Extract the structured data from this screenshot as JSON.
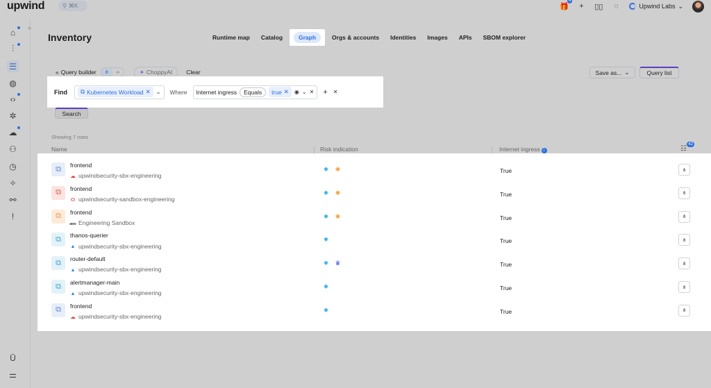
{
  "header": {
    "logo_text": "upwind",
    "search_hint": "⌘K",
    "notifications_count": "4",
    "org_name": "Upwind Labs"
  },
  "page": {
    "title": "Inventory",
    "tabs": [
      {
        "label": "Runtime map"
      },
      {
        "label": "Catalog"
      },
      {
        "label": "Graph"
      },
      {
        "label": "Orgs & accounts"
      },
      {
        "label": "Identities"
      },
      {
        "label": "Images"
      },
      {
        "label": "APIs"
      },
      {
        "label": "SBOM explorer"
      }
    ]
  },
  "query": {
    "builder_label": "Query builder",
    "ai_label": "ChoppyAI",
    "clear_label": "Clear",
    "save_as_label": "Save as...",
    "query_list_label": "Query list",
    "find_label": "Find",
    "entity": "Kubernetes Workload",
    "where_label": "Where",
    "condition_field": "Internet ingress",
    "condition_op": "Equals",
    "condition_value": "true",
    "search_label": "Search"
  },
  "table": {
    "row_count_text": "Showing 7 rows",
    "columns": {
      "name": "Name",
      "risk": "Risk indication",
      "ingress": "Internet ingress"
    },
    "columns_badge": "42",
    "rows": [
      {
        "name": "frontend",
        "account": "upwindsecurity-sbx-engineering",
        "cloud": "gcp",
        "risks": [
          "kubernetes",
          "bug"
        ],
        "ingress": "True"
      },
      {
        "name": "frontend",
        "account": "upwindsecurity-sandbox-engineering",
        "cloud": "oracle",
        "risks": [
          "kubernetes",
          "bug"
        ],
        "ingress": "True"
      },
      {
        "name": "frontend",
        "account": "Engineering Sandbox",
        "cloud": "aws",
        "risks": [
          "kubernetes",
          "bug"
        ],
        "ingress": "True"
      },
      {
        "name": "thanos-querier",
        "account": "upwindsecurity-sbx-engineering",
        "cloud": "azure",
        "risks": [
          "kubernetes"
        ],
        "ingress": "True"
      },
      {
        "name": "router-default",
        "account": "upwindsecurity-sbx-engineering",
        "cloud": "azure",
        "risks": [
          "kubernetes",
          "crown"
        ],
        "ingress": "True"
      },
      {
        "name": "alertmanager-main",
        "account": "upwindsecurity-sbx-engineering",
        "cloud": "azure",
        "risks": [
          "kubernetes"
        ],
        "ingress": "True"
      },
      {
        "name": "frontend",
        "account": "upwindsecurity-sbx-engineering",
        "cloud": "gcp",
        "risks": [
          "kubernetes"
        ],
        "ingress": "True"
      }
    ]
  },
  "colors": {
    "accent": "#2f6fdc",
    "purple": "#5b3fbf",
    "bug": "#f0a23a",
    "k8s": "#3fb6e8"
  }
}
